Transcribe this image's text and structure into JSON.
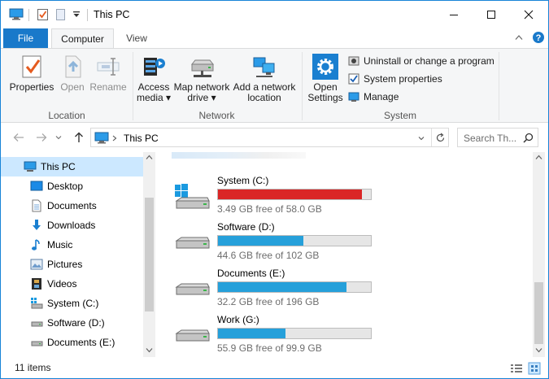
{
  "window": {
    "title": "This PC",
    "accent": "#1979ca"
  },
  "tabs": [
    {
      "label": "File"
    },
    {
      "label": "Computer"
    },
    {
      "label": "View"
    }
  ],
  "ribbon": {
    "location": {
      "label": "Location",
      "buttons": [
        {
          "label": "Properties",
          "icon": "properties-icon"
        },
        {
          "label": "Open",
          "icon": "open-icon"
        },
        {
          "label": "Rename",
          "icon": "rename-icon"
        }
      ]
    },
    "network": {
      "label": "Network",
      "buttons": [
        {
          "line1": "Access",
          "line2": "media",
          "icon": "access-media-icon"
        },
        {
          "line1": "Map network",
          "line2": "drive",
          "icon": "map-drive-icon"
        },
        {
          "line1": "Add a network",
          "line2": "location",
          "icon": "network-location-icon"
        }
      ]
    },
    "system": {
      "label": "System",
      "open_settings": {
        "line1": "Open",
        "line2": "Settings",
        "icon": "gear-icon"
      },
      "items": [
        {
          "label": "Uninstall or change a program",
          "icon": "uninstall-icon"
        },
        {
          "label": "System properties",
          "icon": "system-properties-icon"
        },
        {
          "label": "Manage",
          "icon": "manage-icon"
        }
      ]
    }
  },
  "address": {
    "path": "This PC",
    "search_placeholder": "Search Th..."
  },
  "nav_pane": {
    "items": [
      {
        "label": "This PC",
        "icon": "computer-icon",
        "selected": true
      },
      {
        "label": "Desktop",
        "icon": "desktop-icon"
      },
      {
        "label": "Documents",
        "icon": "documents-icon"
      },
      {
        "label": "Downloads",
        "icon": "downloads-icon"
      },
      {
        "label": "Music",
        "icon": "music-icon"
      },
      {
        "label": "Pictures",
        "icon": "pictures-icon"
      },
      {
        "label": "Videos",
        "icon": "videos-icon"
      },
      {
        "label": "System (C:)",
        "icon": "drive-c-icon"
      },
      {
        "label": "Software (D:)",
        "icon": "drive-icon"
      },
      {
        "label": "Documents (E:)",
        "icon": "drive-icon"
      }
    ]
  },
  "drives": [
    {
      "name": "System (C:)",
      "free": "3.49 GB free of 58.0 GB",
      "used_fraction": 0.94,
      "low_space": true,
      "icon": "windows-drive-icon"
    },
    {
      "name": "Software (D:)",
      "free": "44.6 GB free of 102 GB",
      "used_fraction": 0.56,
      "low_space": false,
      "icon": "drive-icon"
    },
    {
      "name": "Documents (E:)",
      "free": "32.2 GB free of 196 GB",
      "used_fraction": 0.84,
      "low_space": false,
      "icon": "drive-icon"
    },
    {
      "name": "Work (G:)",
      "free": "55.9 GB free of 99.9 GB",
      "used_fraction": 0.44,
      "low_space": false,
      "icon": "drive-icon"
    }
  ],
  "status": {
    "items_count": "11 items"
  }
}
